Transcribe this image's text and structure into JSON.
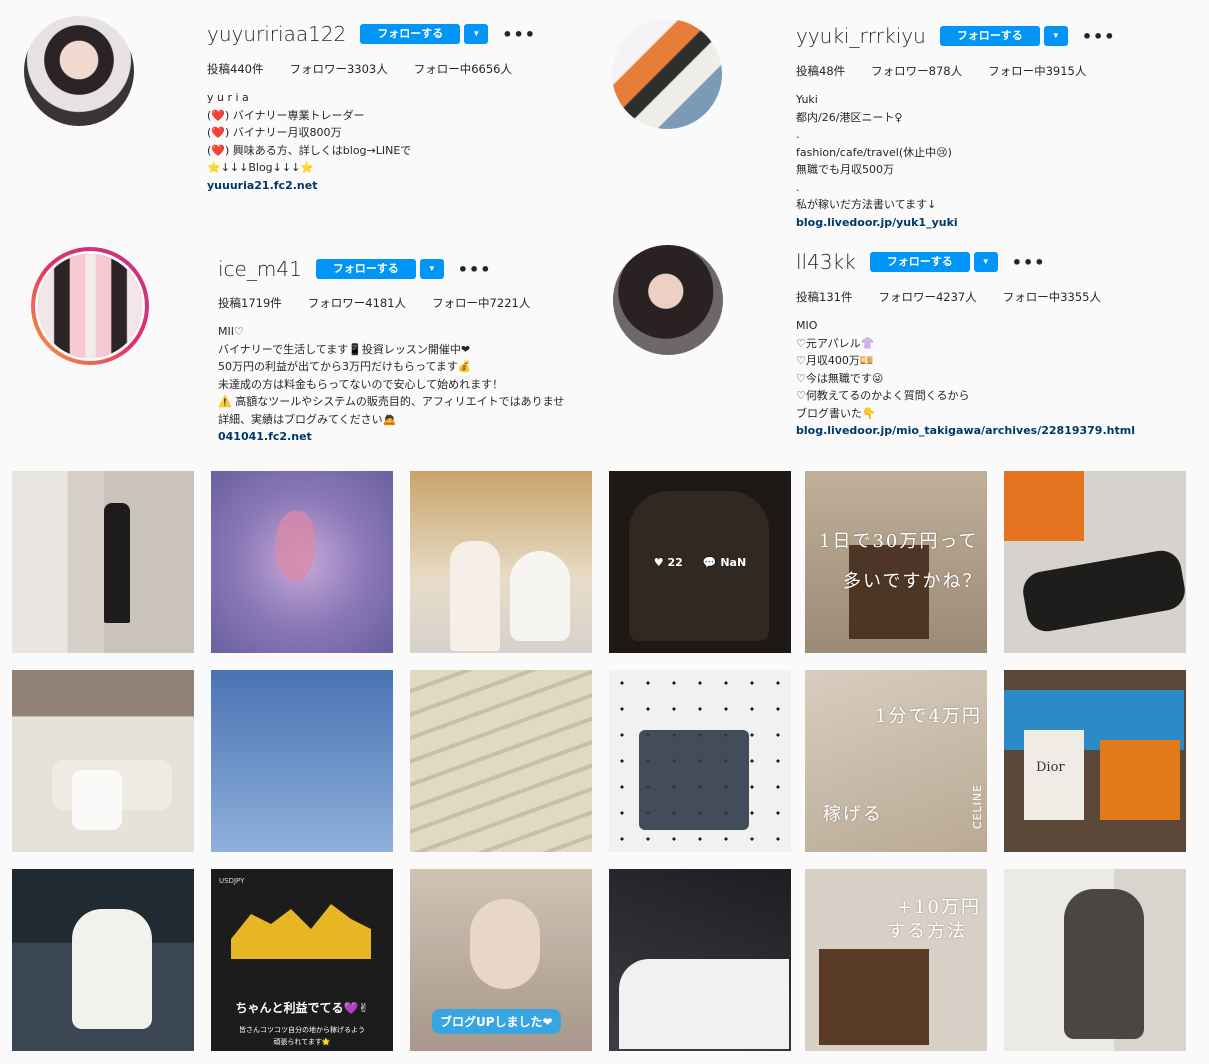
{
  "profiles": [
    {
      "username": "yuyuririaa122",
      "follow_label": "フォローする",
      "more_label": "•••",
      "posts": "投稿440件",
      "followers": "フォロワー3303人",
      "following": "フォロー中6656人",
      "bio": [
        "y u r i a",
        "(❤️) バイナリー専業トレーダー",
        "(❤️) バイナリー月収800万",
        "(❤️) 興味ある方、詳しくはblog→LINEで",
        "⭐↓↓↓Blog↓↓↓⭐"
      ],
      "link": "yuuuria21.fc2.net"
    },
    {
      "username": "yyuki_rrrkiyu",
      "follow_label": "フォローする",
      "more_label": "•••",
      "posts": "投稿48件",
      "followers": "フォロワー878人",
      "following": "フォロー中3915人",
      "bio": [
        "Yuki",
        "都内/26/港区ニート♀",
        ".",
        "fashion/cafe/travel(休止中😢)",
        "無職でも月収500万",
        ".",
        "私が稼いだ方法書いてます↓"
      ],
      "link": "blog.livedoor.jp/yuk1_yuki"
    },
    {
      "username": "ice_m41",
      "follow_label": "フォローする",
      "more_label": "•••",
      "posts": "投稿1719件",
      "followers": "フォロワー4181人",
      "following": "フォロー中7221人",
      "bio": [
        "MII♡",
        "バイナリーで生活してます📱投資レッスン開催中❤",
        "50万円の利益が出てから3万円だけもらってます💰",
        "未達成の方は料金もらってないので安心して始めれます！",
        "⚠️ 高額なツールやシステムの販売目的、アフィリエイトではありませ",
        "詳細、実績はブログみてください🙇"
      ],
      "link": "041041.fc2.net"
    },
    {
      "username": "ll43kk",
      "follow_label": "フォローする",
      "more_label": "•••",
      "posts": "投稿131件",
      "followers": "フォロワー4237人",
      "following": "フォロー中3355人",
      "bio": [
        "MIO",
        "♡元アパレル👚",
        "♡月収400万💴",
        "♡今は無職です😜",
        "♡何教えてるのかよく質問くるから",
        "ブログ書いた👇"
      ],
      "link": "blog.livedoor.jp/mio_takigawa/archives/22819379.html"
    }
  ],
  "grid": {
    "post4_likes": "22",
    "post4_comments": "NaN",
    "post5_text_1": "1日で30万円って",
    "post5_text_2": "多いですかね？",
    "post11_text": "1分で4万円",
    "post11_text_2": "稼げる",
    "post11_brand": "CELINE",
    "post12_brand": "Dior",
    "post14_caption": "ちゃんと利益でてる💜✌",
    "post14_sub_1": "皆さんコツコツ自分の地から稼げるよう",
    "post14_sub_2": "頑張られてます🌟",
    "post14_pair": "USDJPY",
    "post15_caption": "ブログUPしました❤",
    "post17_text_1": "+10万円",
    "post17_text_2": "する方法"
  },
  "colors": {
    "follow_button": "#0095f6",
    "link": "#00376b",
    "background": "#fafafa"
  }
}
